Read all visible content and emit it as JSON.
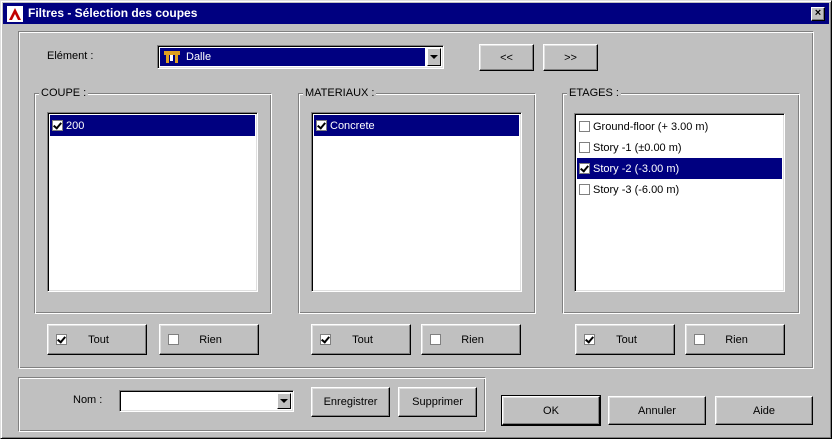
{
  "window": {
    "title": "Filtres - Sélection des coupes",
    "close_glyph": "×"
  },
  "element": {
    "label": "Elément :",
    "value": "Dalle",
    "icon": "slab-icon"
  },
  "nav": {
    "prev": "<<",
    "next": ">>"
  },
  "coupe": {
    "legend": "COUPE :",
    "items": [
      {
        "label": "200",
        "checked": true,
        "selected": true
      }
    ],
    "tout": "Tout",
    "rien": "Rien"
  },
  "materiaux": {
    "legend": "MATERIAUX :",
    "items": [
      {
        "label": "Concrete",
        "checked": true,
        "selected": true
      }
    ],
    "tout": "Tout",
    "rien": "Rien"
  },
  "etages": {
    "legend": "ETAGES :",
    "items": [
      {
        "label": "Ground-floor (+ 3.00 m)",
        "checked": false,
        "selected": false
      },
      {
        "label": "Story -1 (±0.00 m)",
        "checked": false,
        "selected": false
      },
      {
        "label": "Story -2 (-3.00 m)",
        "checked": true,
        "selected": true
      },
      {
        "label": "Story -3 (-6.00 m)",
        "checked": false,
        "selected": false
      }
    ],
    "tout": "Tout",
    "rien": "Rien"
  },
  "nom": {
    "label": "Nom :",
    "value": ""
  },
  "buttons": {
    "save": "Enregistrer",
    "delete": "Supprimer",
    "ok": "OK",
    "cancel": "Annuler",
    "help": "Aide"
  },
  "colors": {
    "titlebar": "#000080",
    "selection": "#000080",
    "face": "#c0c0c0"
  }
}
